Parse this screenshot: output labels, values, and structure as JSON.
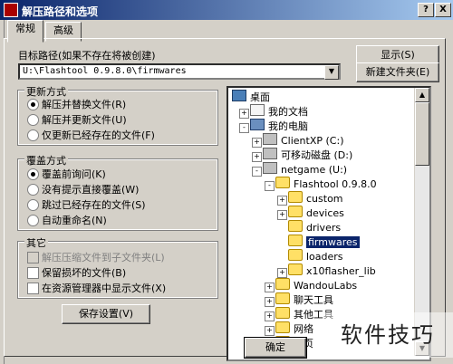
{
  "window": {
    "title": "解压路径和选项",
    "help_label": "?",
    "close_label": "X"
  },
  "tabs": [
    {
      "label": "常规"
    },
    {
      "label": "高级"
    }
  ],
  "target_path": {
    "label": "目标路径(如果不存在将被创建)",
    "value": "U:\\Flashtool 0.9.8.0\\firmwares"
  },
  "buttons": {
    "show": "显示(S)",
    "new_folder": "新建文件夹(E)",
    "save_settings": "保存设置(V)",
    "ok": "确定"
  },
  "update_mode": {
    "title": "更新方式",
    "options": [
      {
        "label": "解压并替换文件(R)",
        "selected": true
      },
      {
        "label": "解压并更新文件(U)",
        "selected": false
      },
      {
        "label": "仅更新已经存在的文件(F)",
        "selected": false
      }
    ]
  },
  "overwrite_mode": {
    "title": "覆盖方式",
    "options": [
      {
        "label": "覆盖前询问(K)",
        "selected": true
      },
      {
        "label": "没有提示直接覆盖(W)",
        "selected": false
      },
      {
        "label": "跳过已经存在的文件(S)",
        "selected": false
      },
      {
        "label": "自动重命名(N)",
        "selected": false
      }
    ]
  },
  "misc": {
    "title": "其它",
    "options": [
      {
        "label": "解压压缩文件到子文件夹(L)",
        "checked": false,
        "disabled": true
      },
      {
        "label": "保留损坏的文件(B)",
        "checked": false,
        "disabled": false
      },
      {
        "label": "在资源管理器中显示文件(X)",
        "checked": false,
        "disabled": false
      }
    ]
  },
  "tree": [
    {
      "label": "桌面",
      "icon": "desktop-icon"
    },
    {
      "label": "我的文档",
      "icon": "documents-icon",
      "expander": "+"
    },
    {
      "label": "我的电脑",
      "icon": "computer-icon",
      "expander": "-"
    },
    {
      "label": "ClientXP (C:)",
      "icon": "drive-icon",
      "expander": "+"
    },
    {
      "label": "可移动磁盘 (D:)",
      "icon": "drive-icon",
      "expander": "+"
    },
    {
      "label": "netgame (U:)",
      "icon": "drive-icon",
      "expander": "-"
    },
    {
      "label": "Flashtool 0.9.8.0",
      "icon": "folder-icon",
      "expander": "-"
    },
    {
      "label": "custom",
      "icon": "folder-icon",
      "expander": "+"
    },
    {
      "label": "devices",
      "icon": "folder-icon",
      "expander": "+"
    },
    {
      "label": "drivers",
      "icon": "folder-icon"
    },
    {
      "label": "firmwares",
      "icon": "folder-icon",
      "selected": true
    },
    {
      "label": "loaders",
      "icon": "folder-icon"
    },
    {
      "label": "x10flasher_lib",
      "icon": "folder-icon",
      "expander": "+"
    },
    {
      "label": "WandouLabs",
      "icon": "folder-icon",
      "expander": "+"
    },
    {
      "label": "聊天工具",
      "icon": "folder-icon",
      "expander": "+"
    },
    {
      "label": "其他工具",
      "icon": "folder-icon",
      "expander": "+"
    },
    {
      "label": "网络",
      "icon": "folder-icon",
      "expander": "+"
    },
    {
      "label": "网页",
      "icon": "folder-icon",
      "expander": "+"
    }
  ],
  "watermark": {
    "text": "软件技巧"
  }
}
